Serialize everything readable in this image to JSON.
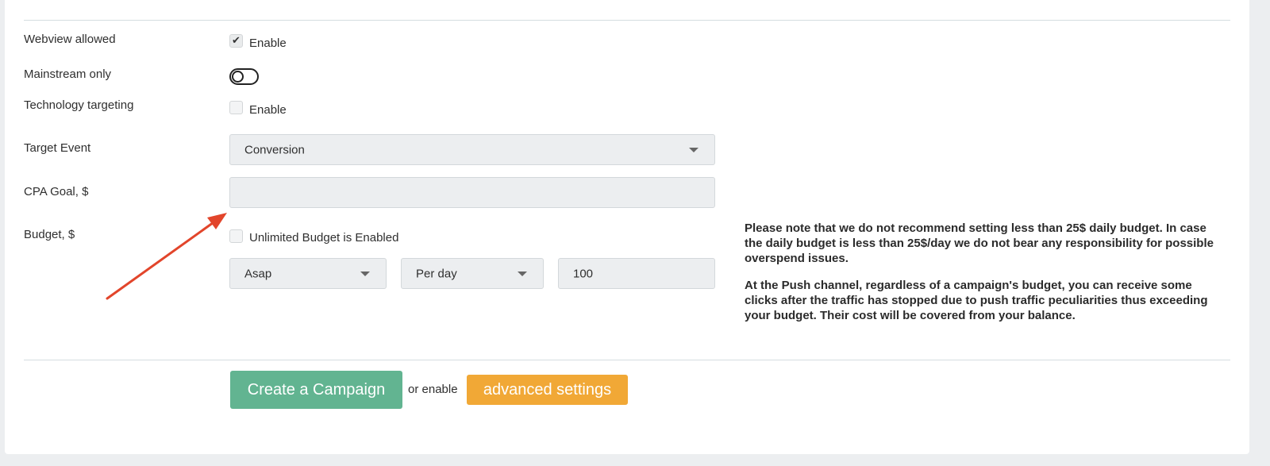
{
  "form": {
    "webview": {
      "label": "Webview allowed",
      "checkbox_label": "Enable",
      "checked": true
    },
    "mainstream": {
      "label": "Mainstream only",
      "toggle_on": false
    },
    "technology": {
      "label": "Technology targeting",
      "checkbox_label": "Enable",
      "checked": false
    },
    "target_event": {
      "label": "Target Event",
      "selected": "Conversion"
    },
    "cpa_goal": {
      "label": "CPA Goal, $",
      "value": ""
    },
    "budget": {
      "label": "Budget, $",
      "unlimited_label": "Unlimited Budget is Enabled",
      "unlimited_checked": false,
      "pacing_selected": "Asap",
      "period_selected": "Per day",
      "amount": "100"
    }
  },
  "notes": {
    "paragraph1": "Please note that we do not recommend setting less than 25$ daily budget. In case the daily budget is less than 25$/day we do not bear any responsibility for possible overspend issues.",
    "paragraph2": "At the Push channel, regardless of a campaign's budget, you can receive some clicks after the traffic has stopped due to push traffic peculiarities thus exceeding your budget. Their cost will be covered from your balance."
  },
  "actions": {
    "create_label": "Create a Campaign",
    "or_text": "or enable",
    "advanced_label": "advanced settings"
  },
  "colors": {
    "create_button": "#62b491",
    "advanced_button": "#f1a836",
    "arrow": "#e2452b"
  }
}
